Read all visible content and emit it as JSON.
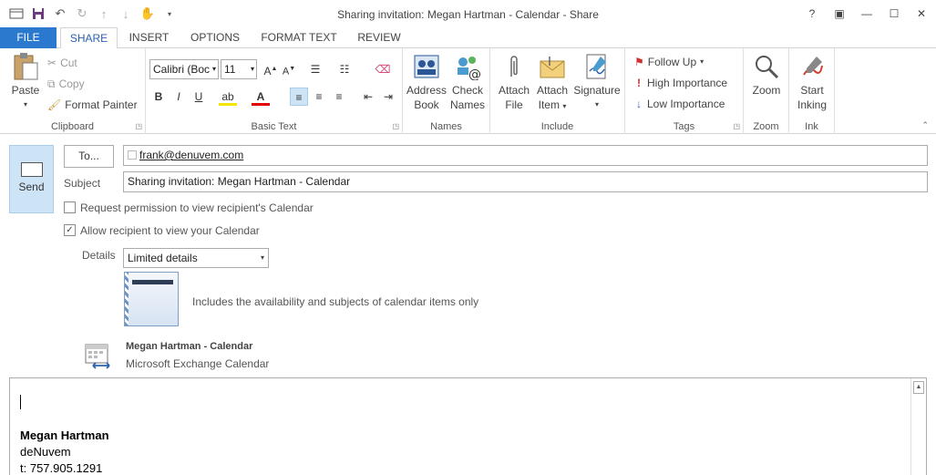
{
  "window": {
    "title": "Sharing invitation: Megan Hartman - Calendar - Share",
    "help": "?",
    "controls": [
      "▣",
      "—",
      "☐",
      "✕"
    ]
  },
  "tabs": [
    {
      "label": "FILE"
    },
    {
      "label": "SHARE"
    },
    {
      "label": "INSERT"
    },
    {
      "label": "OPTIONS"
    },
    {
      "label": "FORMAT TEXT"
    },
    {
      "label": "REVIEW"
    }
  ],
  "ribbon": {
    "clipboard": {
      "paste": "Paste",
      "cut": "Cut",
      "copy": "Copy",
      "format_painter": "Format Painter",
      "label": "Clipboard"
    },
    "basic_text": {
      "font": "Calibri (Boc",
      "size": "11",
      "bold": "B",
      "italic": "I",
      "underline": "U",
      "label": "Basic Text"
    },
    "names": {
      "address_book_1": "Address",
      "address_book_2": "Book",
      "check_names_1": "Check",
      "check_names_2": "Names",
      "label": "Names"
    },
    "include": {
      "attach_file_1": "Attach",
      "attach_file_2": "File",
      "attach_item_1": "Attach",
      "attach_item_2": "Item",
      "signature": "Signature",
      "label": "Include"
    },
    "tags": {
      "follow_up": "Follow Up",
      "high": "High Importance",
      "low": "Low Importance",
      "label": "Tags"
    },
    "zoom": {
      "zoom": "Zoom",
      "label": "Zoom"
    },
    "ink": {
      "start_1": "Start",
      "start_2": "Inking",
      "label": "Ink"
    }
  },
  "compose": {
    "send": "Send",
    "to_button": "To...",
    "to_value": "frank@denuvem.com",
    "subject_label": "Subject",
    "subject_value": "Sharing invitation: Megan Hartman - Calendar",
    "request_permission": "Request permission to view recipient's Calendar",
    "request_checked": false,
    "allow_view": "Allow recipient to view your Calendar",
    "allow_checked": true,
    "details_label": "Details",
    "details_value": "Limited details",
    "details_description": "Includes the availability and subjects of calendar items only",
    "calendar_name": "Megan Hartman - Calendar",
    "calendar_type": "Microsoft Exchange Calendar"
  },
  "body": {
    "name": "Megan Hartman",
    "company": "deNuvem",
    "phone": "t: 757.905.1291"
  }
}
